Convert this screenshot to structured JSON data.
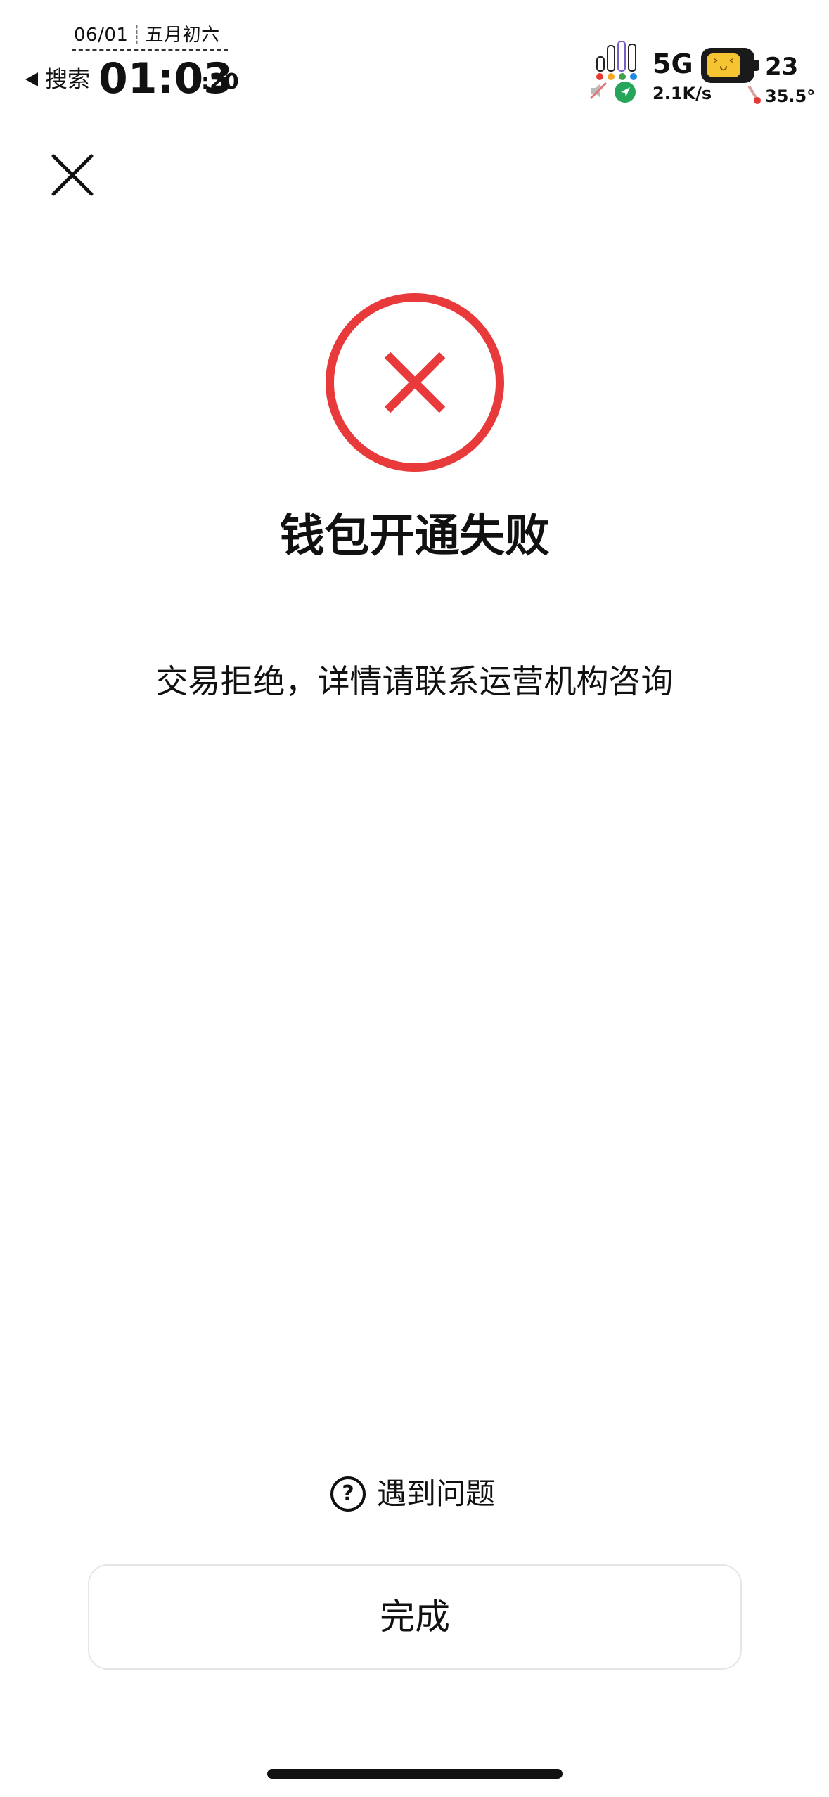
{
  "status_bar": {
    "date": "06/01",
    "lunar_date": "五月初六",
    "back_label": "搜索",
    "time": "01:03",
    "seconds": ":20",
    "network": "5G",
    "net_speed": "2.1K/s",
    "battery_level": "23",
    "temperature": "35.5°",
    "icons": [
      "signal-bars-icon",
      "mute-icon",
      "location-icon",
      "battery-icon",
      "thermometer-icon"
    ]
  },
  "header": {
    "close_icon": "close-icon"
  },
  "result": {
    "status_icon": "error-circle-icon",
    "title": "钱包开通失败",
    "message": "交易拒绝，详情请联系运营机构咨询"
  },
  "help": {
    "icon": "question-circle-icon",
    "label": "遇到问题"
  },
  "actions": {
    "done_label": "完成"
  },
  "colors": {
    "error_red": "#e83a3b",
    "text": "#111111",
    "button_border": "#e6e6e6"
  }
}
